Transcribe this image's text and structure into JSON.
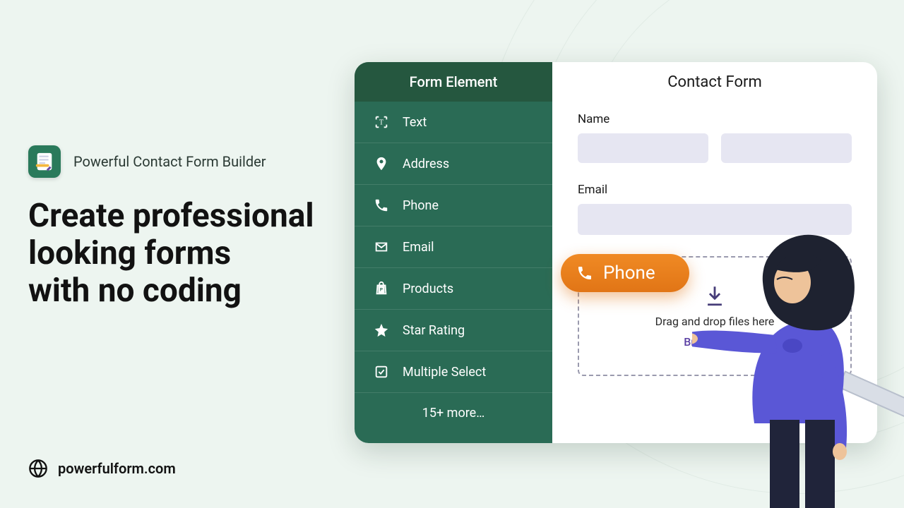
{
  "brand": {
    "name": "Powerful Contact Form Builder"
  },
  "headline": "Create professional looking forms\nwith no coding",
  "site": "powerfulform.com",
  "builder": {
    "sidebar_title": "Form Element",
    "elements": {
      "text": {
        "label": "Text"
      },
      "address": {
        "label": "Address"
      },
      "phone": {
        "label": "Phone"
      },
      "email": {
        "label": "Email"
      },
      "products": {
        "label": "Products"
      },
      "star": {
        "label": "Star Rating"
      },
      "multi": {
        "label": "Multiple Select"
      }
    },
    "more": "15+ more…"
  },
  "preview": {
    "title": "Contact Form",
    "name_label": "Name",
    "email_label": "Email",
    "dropzone_text": "Drag and drop files here",
    "browse_text": "Browse files"
  },
  "drag_chip": {
    "label": "Phone"
  }
}
